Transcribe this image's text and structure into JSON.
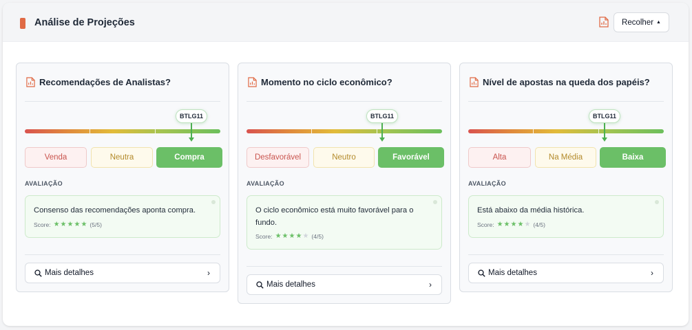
{
  "header": {
    "title": "Análise de Projeções",
    "collapse_label": "Recolher",
    "accent_color": "#e06a45"
  },
  "cards": [
    {
      "title": "Recomendações de Analistas?",
      "ticker": "BTLG11",
      "options": [
        "Venda",
        "Neutra",
        "Compra"
      ],
      "selected_index": 2,
      "eval_label": "AVALIAÇÃO",
      "eval_text": "Consenso das recomendações aponta compra.",
      "score_label": "Score:",
      "score": 5,
      "score_max": 5,
      "score_text": "(5/5)",
      "details_label": "Mais detalhes"
    },
    {
      "title": "Momento no ciclo econômico?",
      "ticker": "BTLG11",
      "options": [
        "Desfavorável",
        "Neutro",
        "Favorável"
      ],
      "selected_index": 2,
      "eval_label": "AVALIAÇÃO",
      "eval_text": "O ciclo econômico está muito favorável para o fundo.",
      "score_label": "Score:",
      "score": 4,
      "score_max": 5,
      "score_text": "(4/5)",
      "details_label": "Mais detalhes"
    },
    {
      "title": "Nível de apostas na queda dos papéis?",
      "ticker": "BTLG11",
      "options": [
        "Alta",
        "Na Média",
        "Baixa"
      ],
      "selected_index": 2,
      "eval_label": "AVALIAÇÃO",
      "eval_text": "Está abaixo da média histórica.",
      "score_label": "Score:",
      "score": 4,
      "score_max": 5,
      "score_text": "(4/5)",
      "details_label": "Mais detalhes"
    }
  ],
  "colors": {
    "positive": "#6bbf67",
    "negative": "#c9544e",
    "neutral": "#b38a2a"
  },
  "icons": {
    "report": "report-chart-icon",
    "search": "search-icon",
    "chevron": "chevron-right-icon",
    "star": "star-icon"
  }
}
